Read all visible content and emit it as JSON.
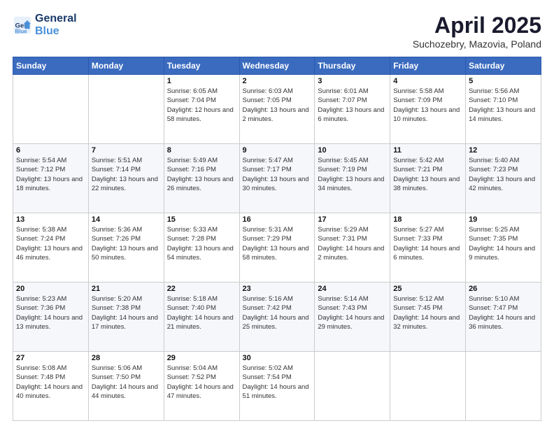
{
  "logo": {
    "line1": "General",
    "line2": "Blue"
  },
  "title": "April 2025",
  "subtitle": "Suchozebry, Mazovia, Poland",
  "headers": [
    "Sunday",
    "Monday",
    "Tuesday",
    "Wednesday",
    "Thursday",
    "Friday",
    "Saturday"
  ],
  "weeks": [
    [
      null,
      null,
      {
        "day": 1,
        "sunrise": "6:05 AM",
        "sunset": "7:04 PM",
        "daylight": "12 hours and 58 minutes."
      },
      {
        "day": 2,
        "sunrise": "6:03 AM",
        "sunset": "7:05 PM",
        "daylight": "13 hours and 2 minutes."
      },
      {
        "day": 3,
        "sunrise": "6:01 AM",
        "sunset": "7:07 PM",
        "daylight": "13 hours and 6 minutes."
      },
      {
        "day": 4,
        "sunrise": "5:58 AM",
        "sunset": "7:09 PM",
        "daylight": "13 hours and 10 minutes."
      },
      {
        "day": 5,
        "sunrise": "5:56 AM",
        "sunset": "7:10 PM",
        "daylight": "13 hours and 14 minutes."
      }
    ],
    [
      {
        "day": 6,
        "sunrise": "5:54 AM",
        "sunset": "7:12 PM",
        "daylight": "13 hours and 18 minutes."
      },
      {
        "day": 7,
        "sunrise": "5:51 AM",
        "sunset": "7:14 PM",
        "daylight": "13 hours and 22 minutes."
      },
      {
        "day": 8,
        "sunrise": "5:49 AM",
        "sunset": "7:16 PM",
        "daylight": "13 hours and 26 minutes."
      },
      {
        "day": 9,
        "sunrise": "5:47 AM",
        "sunset": "7:17 PM",
        "daylight": "13 hours and 30 minutes."
      },
      {
        "day": 10,
        "sunrise": "5:45 AM",
        "sunset": "7:19 PM",
        "daylight": "13 hours and 34 minutes."
      },
      {
        "day": 11,
        "sunrise": "5:42 AM",
        "sunset": "7:21 PM",
        "daylight": "13 hours and 38 minutes."
      },
      {
        "day": 12,
        "sunrise": "5:40 AM",
        "sunset": "7:23 PM",
        "daylight": "13 hours and 42 minutes."
      }
    ],
    [
      {
        "day": 13,
        "sunrise": "5:38 AM",
        "sunset": "7:24 PM",
        "daylight": "13 hours and 46 minutes."
      },
      {
        "day": 14,
        "sunrise": "5:36 AM",
        "sunset": "7:26 PM",
        "daylight": "13 hours and 50 minutes."
      },
      {
        "day": 15,
        "sunrise": "5:33 AM",
        "sunset": "7:28 PM",
        "daylight": "13 hours and 54 minutes."
      },
      {
        "day": 16,
        "sunrise": "5:31 AM",
        "sunset": "7:29 PM",
        "daylight": "13 hours and 58 minutes."
      },
      {
        "day": 17,
        "sunrise": "5:29 AM",
        "sunset": "7:31 PM",
        "daylight": "14 hours and 2 minutes."
      },
      {
        "day": 18,
        "sunrise": "5:27 AM",
        "sunset": "7:33 PM",
        "daylight": "14 hours and 6 minutes."
      },
      {
        "day": 19,
        "sunrise": "5:25 AM",
        "sunset": "7:35 PM",
        "daylight": "14 hours and 9 minutes."
      }
    ],
    [
      {
        "day": 20,
        "sunrise": "5:23 AM",
        "sunset": "7:36 PM",
        "daylight": "14 hours and 13 minutes."
      },
      {
        "day": 21,
        "sunrise": "5:20 AM",
        "sunset": "7:38 PM",
        "daylight": "14 hours and 17 minutes."
      },
      {
        "day": 22,
        "sunrise": "5:18 AM",
        "sunset": "7:40 PM",
        "daylight": "14 hours and 21 minutes."
      },
      {
        "day": 23,
        "sunrise": "5:16 AM",
        "sunset": "7:42 PM",
        "daylight": "14 hours and 25 minutes."
      },
      {
        "day": 24,
        "sunrise": "5:14 AM",
        "sunset": "7:43 PM",
        "daylight": "14 hours and 29 minutes."
      },
      {
        "day": 25,
        "sunrise": "5:12 AM",
        "sunset": "7:45 PM",
        "daylight": "14 hours and 32 minutes."
      },
      {
        "day": 26,
        "sunrise": "5:10 AM",
        "sunset": "7:47 PM",
        "daylight": "14 hours and 36 minutes."
      }
    ],
    [
      {
        "day": 27,
        "sunrise": "5:08 AM",
        "sunset": "7:48 PM",
        "daylight": "14 hours and 40 minutes."
      },
      {
        "day": 28,
        "sunrise": "5:06 AM",
        "sunset": "7:50 PM",
        "daylight": "14 hours and 44 minutes."
      },
      {
        "day": 29,
        "sunrise": "5:04 AM",
        "sunset": "7:52 PM",
        "daylight": "14 hours and 47 minutes."
      },
      {
        "day": 30,
        "sunrise": "5:02 AM",
        "sunset": "7:54 PM",
        "daylight": "14 hours and 51 minutes."
      },
      null,
      null,
      null
    ]
  ]
}
